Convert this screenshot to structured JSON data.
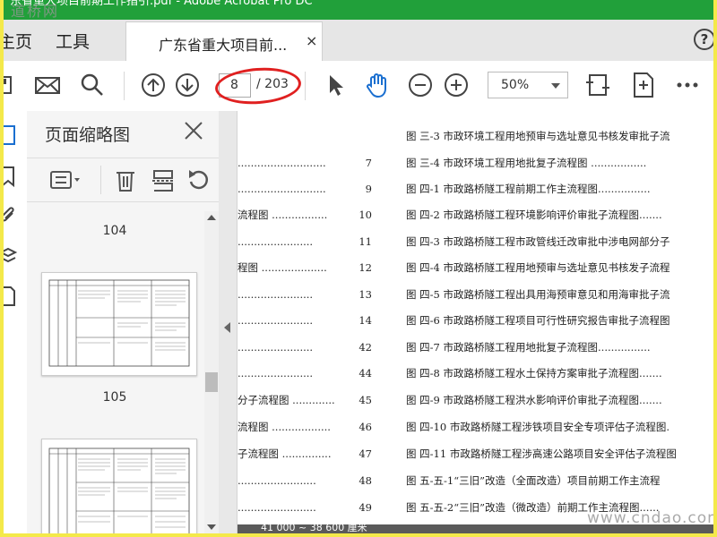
{
  "window": {
    "title": "广东省重大项目前期工作指引.pdf - Adobe Acrobat Pro DC",
    "watermark_top": "道桥网",
    "watermark_bottom": "www.cndao.com"
  },
  "nav": {
    "home_label": "主页",
    "tools_label": "工具",
    "doc_tab_label": "广东省重大项目前...",
    "doc_tab_close": "×",
    "help": "?"
  },
  "toolbar": {
    "current_page": "8",
    "total_pages": "/ 203",
    "zoom": "50%",
    "annotation_color": "#e02020",
    "hand_color": "#1a6fd0"
  },
  "panel": {
    "title": "页面缩略图",
    "pages": [
      "104",
      "105"
    ]
  },
  "toc": {
    "left": [
      {
        "lead": "",
        "num": ""
      },
      {
        "lead": "...........................",
        "num": "7"
      },
      {
        "lead": "...........................",
        "num": "9"
      },
      {
        "lead": "流程图 .................",
        "num": "10"
      },
      {
        "lead": ".......................",
        "num": "11"
      },
      {
        "lead": "程图 ....................",
        "num": "12"
      },
      {
        "lead": ".......................",
        "num": "13"
      },
      {
        "lead": ".......................",
        "num": "14"
      },
      {
        "lead": ".......................",
        "num": "42"
      },
      {
        "lead": ".......................",
        "num": "44"
      },
      {
        "lead": "分子流程图 .............",
        "num": "45"
      },
      {
        "lead": "流程图 ..................",
        "num": "46"
      },
      {
        "lead": "子流程图 ...............",
        "num": "47"
      },
      {
        "lead": "........................",
        "num": "48"
      },
      {
        "lead": "........................",
        "num": "49"
      }
    ],
    "right": [
      "图 三-3 市政环境工程用地预审与选址意见书核发审批子流",
      "图 三-4 市政环境工程用地批复子流程图 .................",
      "图 四-1 市政路桥隧工程前期工作主流程图................",
      "图 四-2 市政路桥隧工程环境影响评价审批子流程图.......",
      "图 四-3 市政路桥隧工程市政管线迁改审批中涉电网部分子",
      "图 四-4 市政路桥隧工程用地预审与选址意见书核发子流程",
      "图 四-5 市政路桥隧工程出具用海预审意见和用海审批子流",
      "图 四-6 市政路桥隧工程项目可行性研究报告审批子流程图",
      "图 四-7 市政路桥隧工程用地批复子流程图................",
      "图 四-8 市政路桥隧工程水土保持方案审批子流程图.......",
      "图 四-9 市政路桥隧工程洪水影响评价审批子流程图.......",
      "图 四-10 市政路桥隧工程涉铁项目安全专项评估子流程图.",
      "图 四-11 市政路桥隧工程涉高速公路项目安全评估子流程图",
      "图 五-五-1“三旧”改造（全面改造）项目前期工作主流程",
      "图 五-五-2“三旧”改造（微改造）前期工作主流程图......"
    ],
    "bottom_text": "41 000 ~ 38 600 厘米"
  }
}
